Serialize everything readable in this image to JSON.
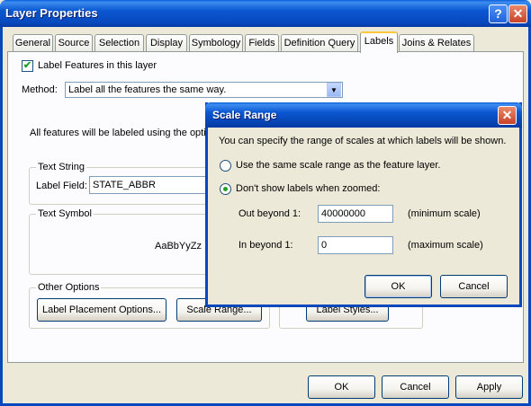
{
  "window": {
    "title": "Layer Properties"
  },
  "tabs": [
    "General",
    "Source",
    "Selection",
    "Display",
    "Symbology",
    "Fields",
    "Definition Query",
    "Labels",
    "Joins & Relates"
  ],
  "labels_tab": {
    "label_features": "Label Features in this layer",
    "method_label": "Method:",
    "method_value": "Label all the features the same way.",
    "all_features_text": "All features will be labeled using the options",
    "text_string": {
      "legend": "Text String",
      "label_field": "Label Field:",
      "field_value": "STATE_ABBR"
    },
    "text_symbol": {
      "legend": "Text Symbol",
      "preview": "AaBbYyZz"
    },
    "other_options": {
      "legend": "Other Options",
      "placement_button": "Label Placement Options...",
      "scale_button": "Scale Range...",
      "styles_button": "Label Styles..."
    }
  },
  "footer": {
    "ok": "OK",
    "cancel": "Cancel",
    "apply": "Apply"
  },
  "scale_dialog": {
    "title": "Scale Range",
    "description": "You can specify the range of scales at which labels will be shown.",
    "option_same": "Use the same scale range as the feature layer.",
    "option_dont_show": "Don't show labels when zoomed:",
    "out_beyond_label": "Out beyond  1:",
    "out_beyond_value": "40000000",
    "out_beyond_hint": "(minimum scale)",
    "in_beyond_label": "In beyond  1:",
    "in_beyond_value": "0",
    "in_beyond_hint": "(maximum scale)",
    "ok": "OK",
    "cancel": "Cancel"
  },
  "colors": {
    "titlebar": "#0a57d1",
    "face": "#ece9d8",
    "close_button": "#c8432a"
  }
}
